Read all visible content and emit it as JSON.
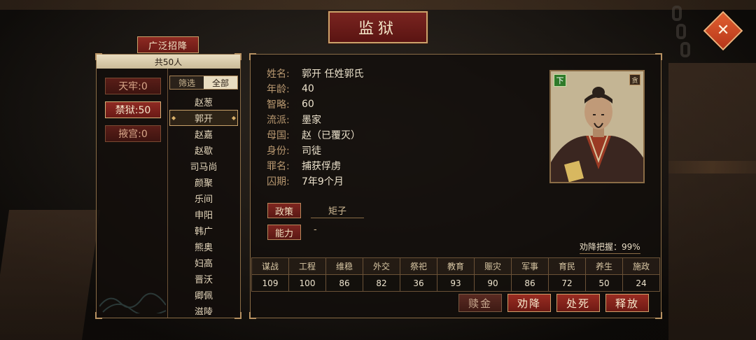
{
  "title": "监狱",
  "recruit_button": "广泛招降",
  "left": {
    "total": "共50人",
    "prisons": [
      {
        "label": "天牢:0",
        "active": false
      },
      {
        "label": "禁狱:50",
        "active": true
      },
      {
        "label": "掖宫:0",
        "active": false
      }
    ],
    "filter_tabs": [
      "筛选",
      "全部"
    ],
    "names": [
      "赵葱",
      "郭开",
      "赵嘉",
      "赵歇",
      "司马尚",
      "颜聚",
      "乐间",
      "申阳",
      "韩广",
      "熊奥",
      "妇高",
      "晋沃",
      "卿佩",
      "滋陵"
    ],
    "selected_index": 1
  },
  "detail": {
    "fields": [
      {
        "label": "姓名:",
        "value": "郭开  任姓郭氏"
      },
      {
        "label": "年龄:",
        "value": "40"
      },
      {
        "label": "智略:",
        "value": "60"
      },
      {
        "label": "流派:",
        "value": "墨家"
      },
      {
        "label": "母国:",
        "value": "赵（已覆灭）"
      },
      {
        "label": "身份:",
        "value": "司徒"
      },
      {
        "label": "罪名:",
        "value": "捕获俘虏"
      },
      {
        "label": "囚期:",
        "value": "7年9个月"
      }
    ],
    "policy_label": "政策",
    "policy_value": "矩子",
    "ability_label": "能力",
    "ability_value": "-",
    "portrait": {
      "rank_badge": "下",
      "trait_badge": "贪"
    },
    "surrender_rate": "劝降把握：99%",
    "stats_headers": [
      "谋战",
      "工程",
      "维稳",
      "外交",
      "祭祀",
      "教育",
      "赈灾",
      "军事",
      "育民",
      "养生",
      "施政"
    ],
    "stats_values": [
      "109",
      "100",
      "86",
      "82",
      "36",
      "93",
      "90",
      "86",
      "72",
      "50",
      "24"
    ],
    "actions": [
      {
        "label": "赎金",
        "dim": true
      },
      {
        "label": "劝降",
        "dim": false
      },
      {
        "label": "处死",
        "dim": false
      },
      {
        "label": "释放",
        "dim": false
      }
    ]
  },
  "colors": {
    "accent_red": "#8e2a22",
    "gold_border": "#c9a26a",
    "close_orange": "#e06030"
  },
  "icons": {
    "close": "close-x-icon"
  }
}
